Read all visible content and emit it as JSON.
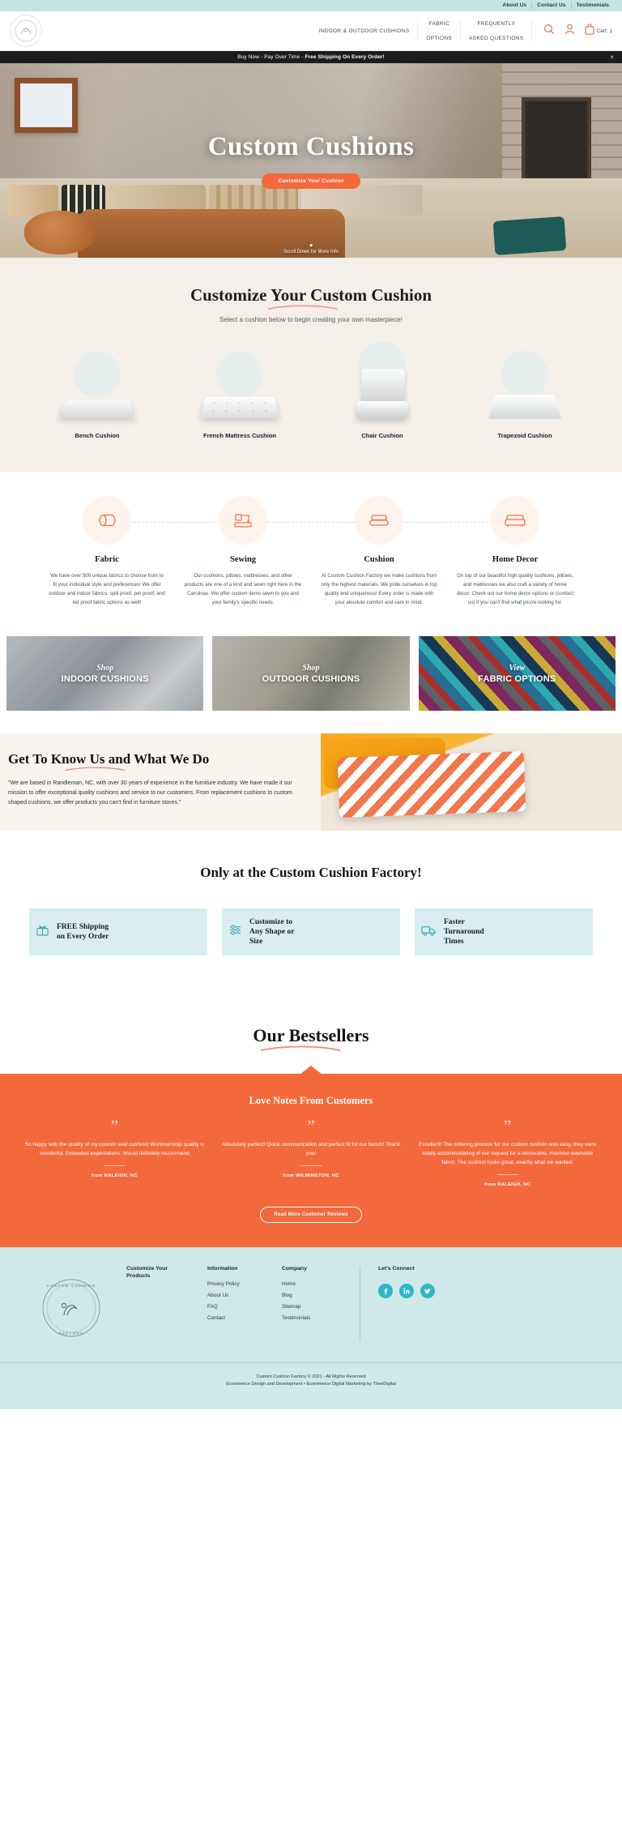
{
  "utility": {
    "links": [
      {
        "label": "About Us"
      },
      {
        "label": "Contact Us"
      },
      {
        "label": "Testimonials"
      }
    ]
  },
  "header": {
    "logo_alt": "Custom Cushion Factory",
    "nav": [
      {
        "line1": "INDOOR & OUTDOOR CUSHIONS",
        "line2": ""
      },
      {
        "line1": "FABRIC",
        "line2": "OPTIONS"
      },
      {
        "line1": "FREQUENTLY",
        "line2": "ASKED QUESTIONS"
      }
    ],
    "cart_label": "Cart: 1"
  },
  "announcement": {
    "text_plain": "Buy Now - Pay Over Time - ",
    "text_bold": "Free Shipping On Every Order!",
    "close": "×"
  },
  "hero": {
    "title": "Custom Cushions",
    "cta": "Customize Your Cushion",
    "scroll_hint": "Scroll Down for More Info"
  },
  "customize": {
    "title": "Customize Your Custom Cushion",
    "subtitle": "Select a cushion below to begin creating your own masterpiece!",
    "cushions": [
      {
        "label": "Bench Cushion"
      },
      {
        "label": "French Mattress Cushion"
      },
      {
        "label": "Chair Cushion"
      },
      {
        "label": "Trapezoid Cushion"
      }
    ]
  },
  "features": [
    {
      "icon": "fabric-roll-icon",
      "title": "Fabric",
      "body": "We have over 500 unique fabrics to choose from to fit your individual style and preferences! We offer outdoor and indoor fabrics, spill proof, pet proof, and kid proof fabric options as well!"
    },
    {
      "icon": "sewing-machine-icon",
      "title": "Sewing",
      "body": "Our cushions, pillows, mattresses, and other products are one of a kind and sewn right here in the Carolinas. We offer custom items sewn to you and your family's specific needs."
    },
    {
      "icon": "cushion-stack-icon",
      "title": "Cushion",
      "body": "At Custom Cushion Factory we make cushions from only the highest materials. We pride ourselves in top quality and uniqueness! Every order is made with your absolute comfort and care in mind."
    },
    {
      "icon": "sofa-icon",
      "title": "Home Decor",
      "body": "On top of our beautiful high quality cushions, pillows, and mattresses we also craft a variety of home decor. Check out our home decor options or (contact us) if you can't find what you're looking for."
    }
  ],
  "banners": [
    {
      "action": "Shop",
      "name": "INDOOR CUSHIONS"
    },
    {
      "action": "Shop",
      "name": "OUTDOOR CUSHIONS"
    },
    {
      "action": "View",
      "name": "FABRIC OPTIONS"
    }
  ],
  "about": {
    "title": "Get To Know Us and What We Do",
    "body": "\"We are based in Randleman, NC, with over 30 years of experience in the furniture industry. We have made it our mission to offer exceptional quality cushions and service to our customers. From replacement cushions to custom shaped cushions, we offer products you can't find in furniture stores.\""
  },
  "only": {
    "title": "Only at the Custom Cushion Factory!",
    "benefits": [
      {
        "icon": "gift-shipping-icon",
        "line1": "FREE Shipping",
        "line2": "on Every Order"
      },
      {
        "icon": "sliders-icon",
        "line1": "Customize to",
        "line2": "Any Shape or",
        "line3": "Size"
      },
      {
        "icon": "truck-icon",
        "line1": "Faster",
        "line2": "Turnaround",
        "line3": "Times"
      }
    ]
  },
  "bestsellers": {
    "title": "Our Bestsellers"
  },
  "testimonials": {
    "title": "Love Notes From Customers",
    "cards": [
      {
        "quote": "So happy with the quality of my custom seat cushion! Workmanship quality is wonderful. Exceeded expectations. Would definitely recommend",
        "from": "from RALEIGH, NC"
      },
      {
        "quote": "Absolutely perfect! Quick communication and perfect fit for our bench! Thank you!",
        "from": "from WILMINGTON, NC"
      },
      {
        "quote": "Excellent! The ordering process for our custom cushion was easy, they were totally accommodating of our request for a removable, machine washable fabric. The cushion looks great, exactly what we wanted.",
        "from": "from RALEIGH, NC"
      }
    ],
    "cta": "Read More Customer Reviews"
  },
  "footer": {
    "columns": [
      {
        "head_line1": "Customize Your",
        "head_line2": "Products",
        "links": []
      },
      {
        "head_line1": "Information",
        "head_line2": "",
        "links": [
          {
            "label": "Privacy Policy"
          },
          {
            "label": "About Us"
          },
          {
            "label": "FAQ"
          },
          {
            "label": "Contact"
          }
        ]
      },
      {
        "head_line1": "Company",
        "head_line2": "",
        "links": [
          {
            "label": "Home"
          },
          {
            "label": "Blog"
          },
          {
            "label": "Sitemap"
          },
          {
            "label": "Testimonials"
          }
        ]
      }
    ],
    "connect_head": "Let's Connect",
    "socials": [
      {
        "name": "facebook-icon",
        "glyph": "f"
      },
      {
        "name": "linkedin-icon",
        "glyph": "in"
      },
      {
        "name": "twitter-icon",
        "glyph": "t"
      }
    ],
    "copyright": "Custom Cushion Factory © 2021 - All Rights Reserved",
    "credit": "Ecommerce Design and Development • Ecommerce Digital Marketing by TheeDigital"
  },
  "colors": {
    "accent_orange": "#f4693c",
    "teal_light": "#cfe8ea",
    "teal_social": "#2fb6c6",
    "cream": "#f4efe9",
    "dark": "#1c1c1c"
  }
}
